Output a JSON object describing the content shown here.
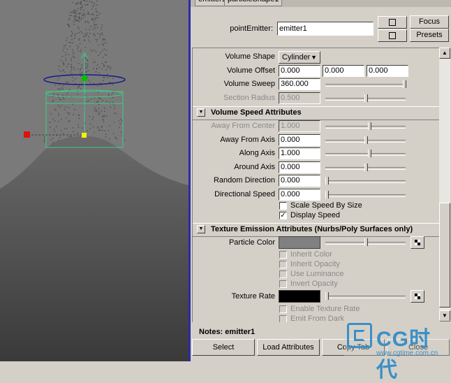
{
  "tabs": [
    "emitter1",
    "particleShape1"
  ],
  "node": {
    "label": "pointEmitter:",
    "value": "emitter1",
    "focus_label": "Focus",
    "presets_label": "Presets",
    "icon_top": "load-input-icon",
    "icon_bottom": "load-output-icon"
  },
  "volume": {
    "shape_label": "Volume Shape",
    "shape_value": "Cylinder",
    "offset_label": "Volume Offset",
    "offset_values": [
      "0.000",
      "0.000",
      "0.000"
    ],
    "sweep_label": "Volume Sweep",
    "sweep_value": "360.000",
    "sweep_slider": 1.0,
    "section_radius_label": "Section Radius",
    "section_radius_value": "0.500",
    "section_radius_slider": 0.5
  },
  "speed_section": {
    "title": "Volume Speed Attributes",
    "rows": [
      {
        "label": "Away From Center",
        "value": "1.000",
        "slider": 0.55,
        "disabled": true
      },
      {
        "label": "Away From Axis",
        "value": "0.000",
        "slider": 0.5,
        "disabled": false
      },
      {
        "label": "Along Axis",
        "value": "1.000",
        "slider": 0.55,
        "disabled": false
      },
      {
        "label": "Around Axis",
        "value": "0.000",
        "slider": 0.5,
        "disabled": false
      },
      {
        "label": "Random Direction",
        "value": "0.000",
        "slider": 0.0,
        "disabled": false
      },
      {
        "label": "Directional Speed",
        "value": "0.000",
        "slider": 0.0,
        "disabled": false
      }
    ],
    "scale_speed_label": "Scale Speed By Size",
    "scale_speed_checked": false,
    "display_speed_label": "Display Speed",
    "display_speed_checked": true
  },
  "texture_section": {
    "title": "Texture Emission Attributes (Nurbs/Poly Surfaces only)",
    "particle_color_label": "Particle Color",
    "particle_color": "#808080",
    "particle_color_slider": 0.5,
    "inherit_color_label": "Inherit Color",
    "inherit_opacity_label": "Inherit Opacity",
    "use_luminance_label": "Use Luminance",
    "invert_opacity_label": "Invert Opacity",
    "texture_rate_label": "Texture Rate",
    "texture_rate_color": "#000000",
    "texture_rate_slider": 0.0,
    "enable_texture_rate_label": "Enable Texture Rate",
    "emit_from_dark_label": "Emit From Dark"
  },
  "notes": {
    "label": "Notes:",
    "value": "emitter1"
  },
  "buttons": {
    "select": "Select",
    "load_attributes": "Load Attributes",
    "copy_tab": "Copy Tab",
    "close": "Close"
  },
  "watermark": {
    "brand": "CG时代",
    "url": "www.cgtime.com.cn"
  },
  "colors": {
    "panel_bg": "#d4d0c8",
    "viewport_bg": "#7a7a7a",
    "accent": "#3a8fc8"
  }
}
